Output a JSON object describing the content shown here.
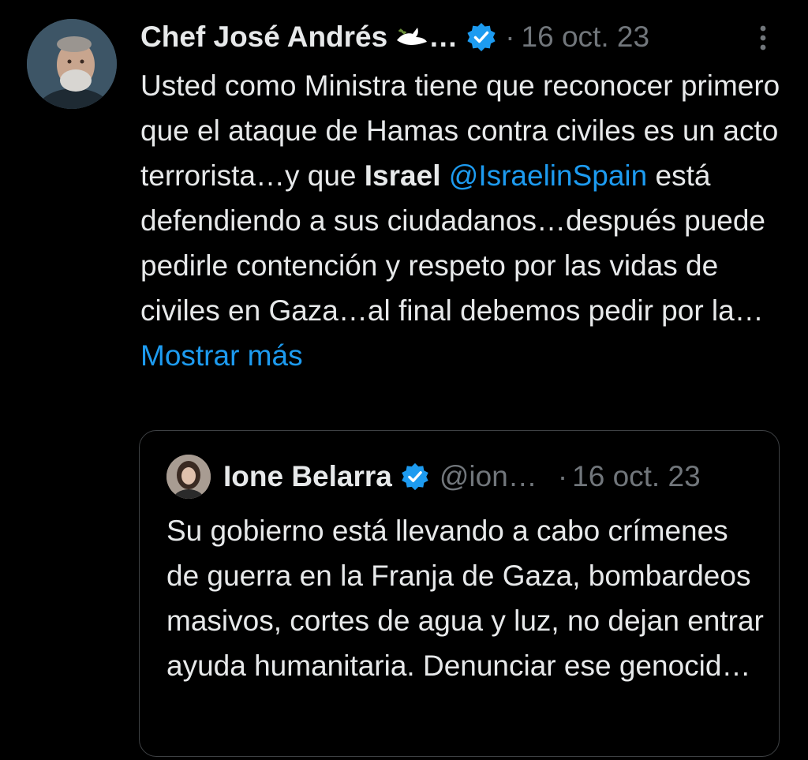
{
  "tweet": {
    "author_name": "Chef José Andrés",
    "author_truncation": "…",
    "dot": "·",
    "date": "16 oct. 23",
    "text": {
      "part1": "Usted como Ministra tiene que reconocer primero que el ataque de Hamas contra civiles es un acto terrorista…y que ",
      "bold": "Israel",
      "mention": "@IsraelinSpain",
      "part2": " está defendiendo a sus ciudadanos…después puede pedirle contención y respeto por las vidas de civiles en Gaza…al final debemos pedir por la… ",
      "show_more": "Mostrar más"
    },
    "icons": {
      "avatar": "avatar-photo-icon",
      "dove": "dove-emoji-icon",
      "verified": "verified-badge-icon",
      "more": "more-options-icon"
    }
  },
  "quoted_tweet": {
    "author_name": "Ione Belarra",
    "handle": "@ion…",
    "dot": "·",
    "date": "16 oct. 23",
    "text": "Su gobierno está llevando a cabo crímenes de guerra en la Franja de Gaza, bombardeos masivos, cortes de agua y luz, no dejan entrar ayuda humanitaria. Denunciar ese genocid…",
    "icons": {
      "avatar": "avatar-photo-icon",
      "verified": "verified-badge-icon"
    }
  },
  "colors": {
    "background": "#000000",
    "text": "#e7e9ea",
    "secondary": "#71767b",
    "link": "#1d9bf0",
    "border": "#3e4144"
  }
}
